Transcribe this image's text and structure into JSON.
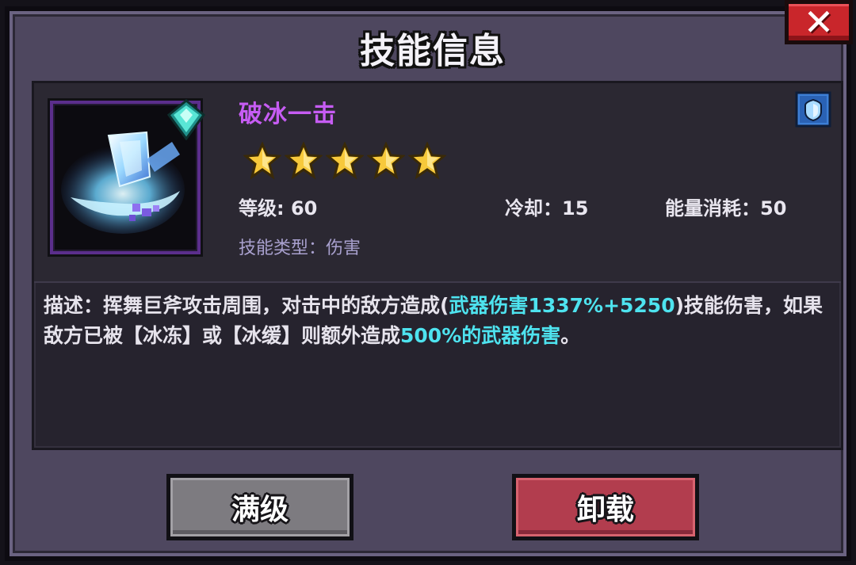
{
  "dialog": {
    "title": "技能信息"
  },
  "skill": {
    "name": "破冰一击",
    "star_count": 5,
    "level_label": "等级: 60",
    "cooldown_label": "冷却：15",
    "energy_label": "能量消耗：50",
    "type_label": "技能类型：伤害"
  },
  "description": {
    "part1": "描述：挥舞巨斧攻击周围，对击中的敌方造成(",
    "highlight1": "武器伤害1337%+5250",
    "part2": ")技能伤害，如果敌方已被【冰冻】或【冰缓】则额外造成",
    "highlight2": "500%的武器伤害",
    "part3": "。"
  },
  "buttons": {
    "max_level": "满级",
    "unload": "卸载"
  },
  "icons": {
    "close": "close-icon",
    "skill": "ice-axe-skill-icon",
    "gem": "diamond-gem-icon",
    "slot": "shield-slot-icon",
    "star": "star-icon"
  },
  "colors": {
    "skill_name": "#c65cf3",
    "highlight": "#4ee3ef",
    "unload_button": "#b23d4e",
    "max_button": "#7d7b80",
    "close_button": "#c9262b"
  }
}
